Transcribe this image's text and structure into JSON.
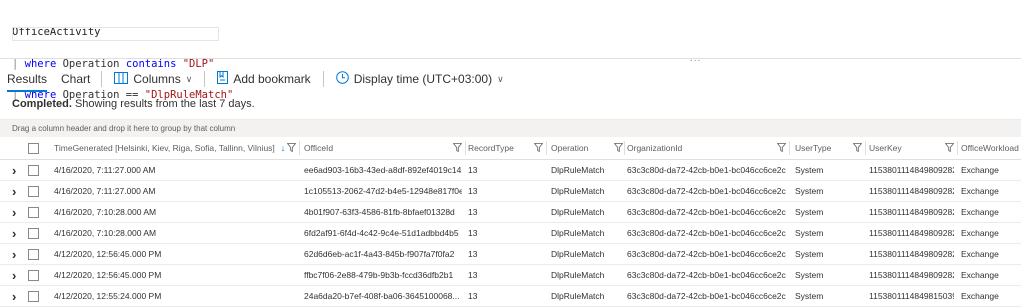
{
  "query": {
    "table": "OfficeActivity",
    "lines": [
      {
        "pipe": "|",
        "kw1": "where",
        "field": " Operation ",
        "kw2": "contains",
        "value": " \"DLP\""
      },
      {
        "pipe": "|",
        "kw1": "where",
        "field": " Operation == ",
        "kw2": "",
        "value": "\"DlpRuleMatch\""
      }
    ],
    "splitter_grip": "..."
  },
  "toolbar": {
    "tabs": [
      "Results",
      "Chart"
    ],
    "columns_label": "Columns",
    "bookmark_label": "Add bookmark",
    "display_time_label": "Display time (UTC+03:00)"
  },
  "status": {
    "bold": "Completed.",
    "text": " Showing results from the last 7 days."
  },
  "groupbar": "Drag a column header and drop it here to group by that column",
  "columns": [
    "TimeGenerated [Helsinki, Kiev, Riga, Sofia, Tallinn, Vilnius]",
    "OfficeId",
    "RecordType",
    "Operation",
    "OrganizationId",
    "UserType",
    "UserKey",
    "OfficeWorkload"
  ],
  "rows": [
    [
      "4/16/2020, 7:11:27.000 AM",
      "ee6ad903-16b3-43ed-a8df-892ef4019c14",
      "13",
      "DlpRuleMatch",
      "63c3c80d-da72-42cb-b0e1-bc046cc6ce2c",
      "System",
      "1153801114849809282",
      "Exchange"
    ],
    [
      "4/16/2020, 7:11:27.000 AM",
      "1c105513-2062-47d2-b4e5-12948e817f0e",
      "13",
      "DlpRuleMatch",
      "63c3c80d-da72-42cb-b0e1-bc046cc6ce2c",
      "System",
      "1153801114849809282",
      "Exchange"
    ],
    [
      "4/16/2020, 7:10:28.000 AM",
      "4b01f907-63f3-4586-81fb-8bfaef01328d",
      "13",
      "DlpRuleMatch",
      "63c3c80d-da72-42cb-b0e1-bc046cc6ce2c",
      "System",
      "1153801114849809282",
      "Exchange"
    ],
    [
      "4/16/2020, 7:10:28.000 AM",
      "6fd2af91-6f4d-4c42-9c4e-51d1adbbd4b5",
      "13",
      "DlpRuleMatch",
      "63c3c80d-da72-42cb-b0e1-bc046cc6ce2c",
      "System",
      "1153801114849809282",
      "Exchange"
    ],
    [
      "4/12/2020, 12:56:45.000 PM",
      "62d6d6eb-ac1f-4a43-845b-f907fa7f0fa2",
      "13",
      "DlpRuleMatch",
      "63c3c80d-da72-42cb-b0e1-bc046cc6ce2c",
      "System",
      "1153801114849809282",
      "Exchange"
    ],
    [
      "4/12/2020, 12:56:45.000 PM",
      "ffbc7f06-2e88-479b-9b3b-fccd36dfb2b1",
      "13",
      "DlpRuleMatch",
      "63c3c80d-da72-42cb-b0e1-bc046cc6ce2c",
      "System",
      "1153801114849809282",
      "Exchange"
    ],
    [
      "4/12/2020, 12:55:24.000 PM",
      "24a6da20-b7ef-408f-ba06-3645100068...",
      "13",
      "DlpRuleMatch",
      "63c3c80d-da72-42cb-b0e1-bc046cc6ce2c",
      "System",
      "1153801114849815039",
      "Exchange"
    ]
  ],
  "icons": {
    "columns": "columns-icon",
    "bookmark": "bookmark-icon",
    "clock": "clock-icon",
    "sort": "sort-down-arrow-icon",
    "filter": "filter-icon",
    "expand": "chevron-right-icon"
  },
  "colors": {
    "accent": "#0078d4",
    "keyword": "#0000ff",
    "string": "#a31515"
  }
}
